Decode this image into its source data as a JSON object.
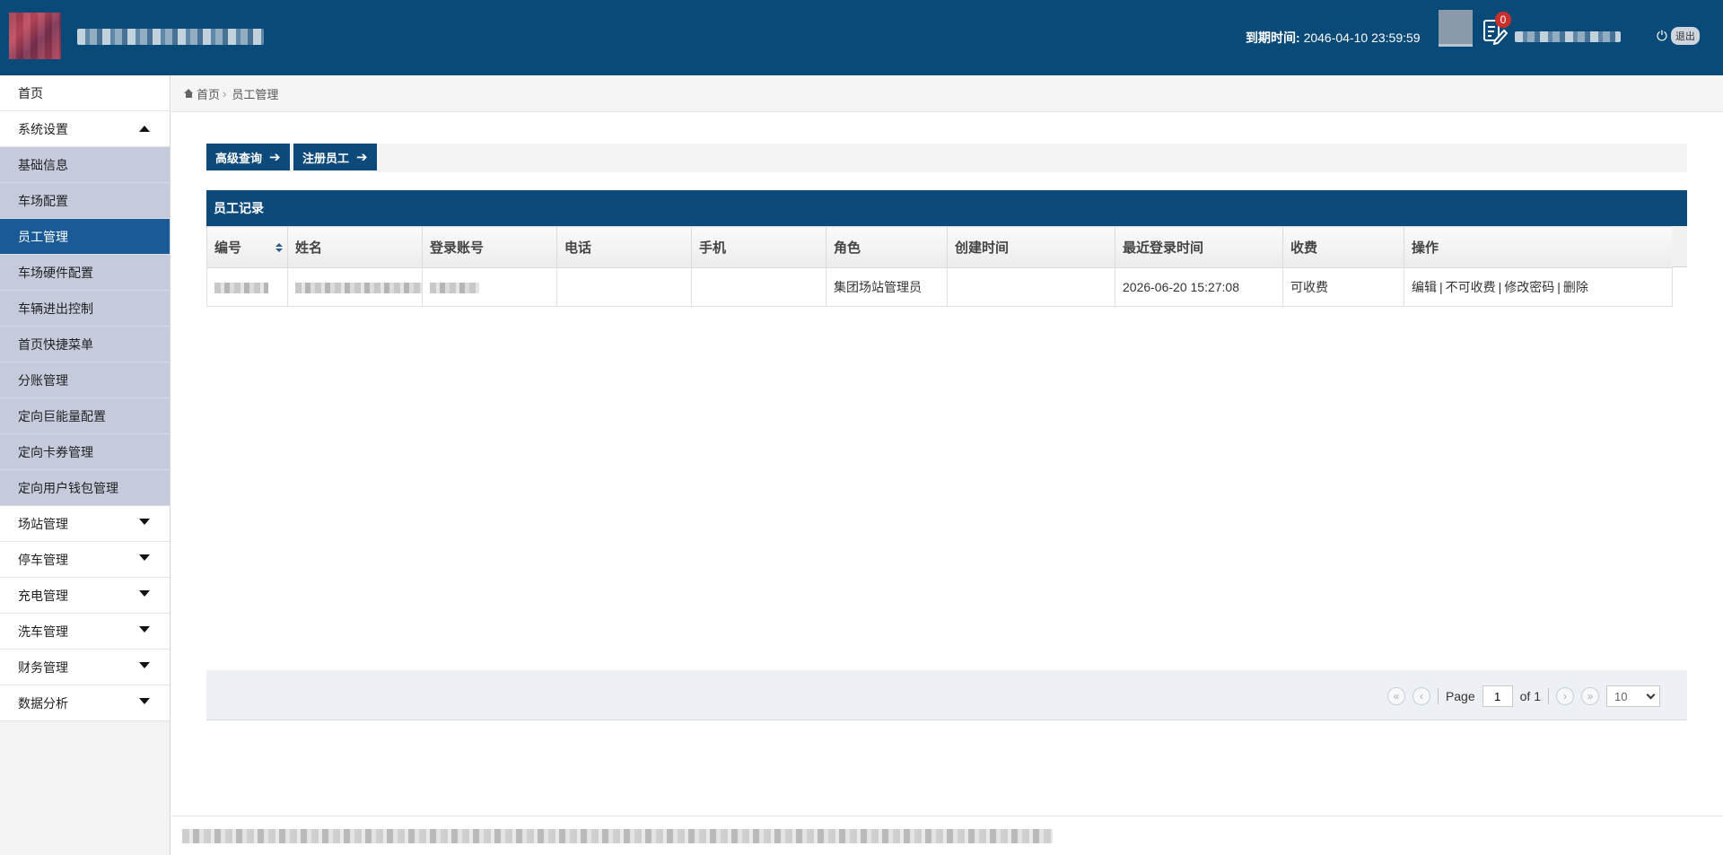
{
  "header": {
    "expiry_label": "到期时间:",
    "expiry_value": "2046-04-10 23:59:59",
    "notification_count": "0",
    "logout_label": "退出"
  },
  "sidebar": {
    "items": [
      {
        "label": "首页"
      },
      {
        "label": "系统设置",
        "expanded": true
      },
      {
        "label": "基础信息"
      },
      {
        "label": "车场配置"
      },
      {
        "label": "员工管理",
        "active": true
      },
      {
        "label": "车场硬件配置"
      },
      {
        "label": "车辆进出控制"
      },
      {
        "label": "首页快捷菜单"
      },
      {
        "label": "分账管理"
      },
      {
        "label": "定向巨能量配置"
      },
      {
        "label": "定向卡券管理"
      },
      {
        "label": "定向用户钱包管理"
      },
      {
        "label": "场站管理"
      },
      {
        "label": "停车管理"
      },
      {
        "label": "充电管理"
      },
      {
        "label": "洗车管理"
      },
      {
        "label": "财务管理"
      },
      {
        "label": "数据分析"
      }
    ]
  },
  "breadcrumb": {
    "home": "首页",
    "current": "员工管理"
  },
  "toolbar": {
    "advanced_query": "高级查询",
    "register_staff": "注册员工"
  },
  "panel": {
    "title": "员工记录"
  },
  "table": {
    "columns": [
      "编号",
      "姓名",
      "登录账号",
      "电话",
      "手机",
      "角色",
      "创建时间",
      "最近登录时间",
      "收费",
      "操作"
    ],
    "rows": [
      {
        "phone": "",
        "mobile": "",
        "role": "集团场站管理员",
        "created": "",
        "last_login": "2026-06-20 15:27:08",
        "charge": "可收费",
        "actions": [
          "编辑",
          "不可收费",
          "修改密码",
          "删除"
        ]
      }
    ]
  },
  "pager": {
    "page_label": "Page",
    "page_value": "1",
    "of_label": "of 1",
    "page_size": "10"
  },
  "colors": {
    "header_bg": "#0a4a78",
    "active_menu": "#1a5a96",
    "submenu_bg": "#c5cadd",
    "button_bg": "#0d4a7c",
    "badge": "#c9302c"
  }
}
